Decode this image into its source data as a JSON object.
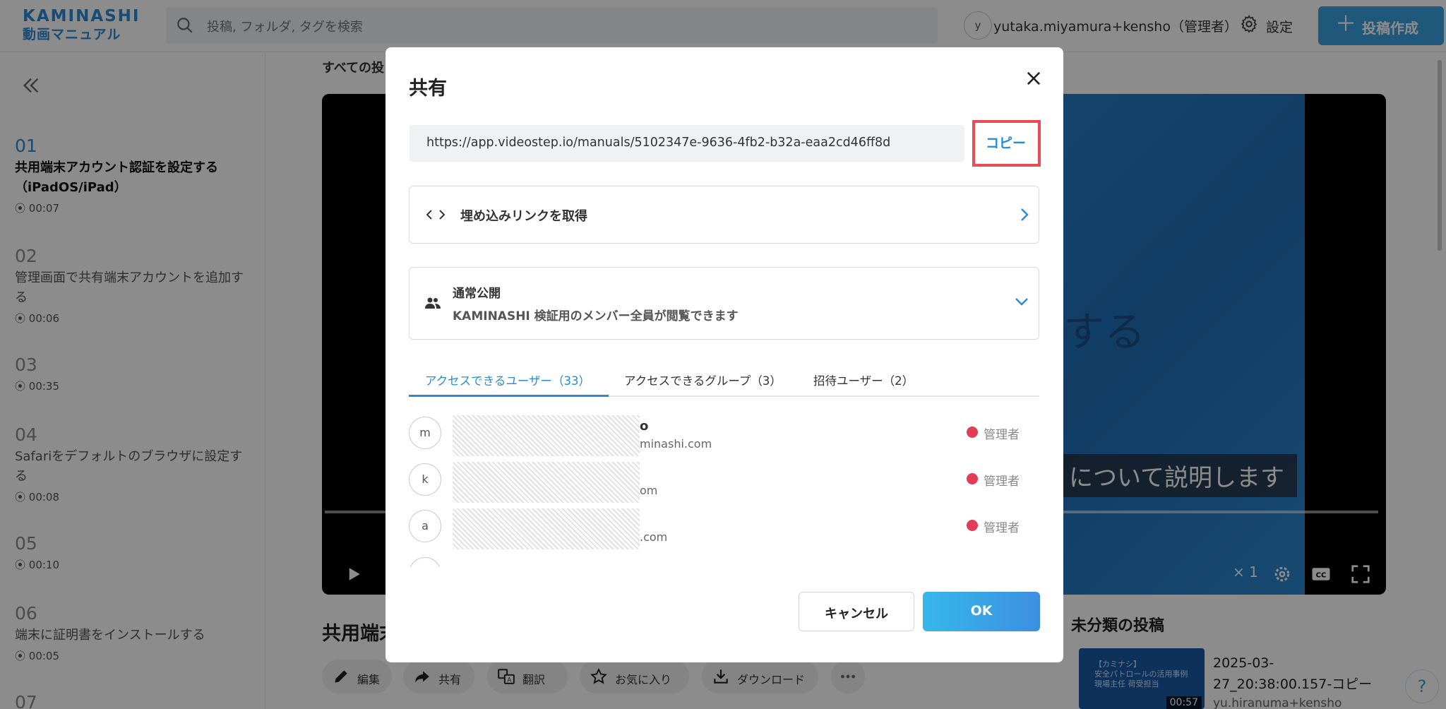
{
  "app": {
    "logo_line1": "KAMINASHI",
    "logo_line2": "動画マニュアル"
  },
  "header": {
    "search_placeholder": "投稿, フォルダ, タグを検索",
    "user_initial": "y",
    "user_name": "yutaka.miyamura+kensho（管理者）",
    "settings_label": "設定",
    "create_label": "投稿作成"
  },
  "sidebar": {
    "steps": [
      {
        "num": "01",
        "title": "共用端末アカウント認証を設定する（iPadOS/iPad）",
        "duration": "00:07"
      },
      {
        "num": "02",
        "title": "管理画面で共有端末アカウントを追加する",
        "duration": "00:06"
      },
      {
        "num": "03",
        "title": "",
        "duration": "00:35"
      },
      {
        "num": "04",
        "title": "Safariをデフォルトのブラウザに設定する",
        "duration": "00:08"
      },
      {
        "num": "05",
        "title": "",
        "duration": "00:10"
      },
      {
        "num": "06",
        "title": "端末に証明書をインストールする",
        "duration": "00:05"
      },
      {
        "num": "07",
        "title": "",
        "duration": ""
      }
    ]
  },
  "main": {
    "all_posts": "すべての投",
    "video_text": "する",
    "caption": "について説明します",
    "playback_rate": "× 1",
    "title": "共用端末",
    "actions": [
      "編集",
      "共有",
      "翻訳",
      "お気に入り",
      "ダウンロード"
    ],
    "right_title": "未分類の投稿",
    "right_item_name": "2025-03-27_20:38:00.157-コピー",
    "right_item_user": "yu.hiranuma+kensho",
    "right_item_duration": "00:57",
    "right_item_thumb_text": "【カミナシ】\n安全パトロールの活用事例\n現場主任 荷受担当"
  },
  "modal": {
    "title": "共有",
    "url": "https://app.videostep.io/manuals/5102347e-9636-4fb2-b32a-eaa2cd46ff8d",
    "copy_label": "コピー",
    "embed_label": "埋め込みリンクを取得",
    "visibility_title": "通常公開",
    "visibility_desc": "KAMINASHI 検証用のメンバー全員が閲覧できます",
    "tabs": [
      "アクセスできるユーザー（33）",
      "アクセスできるグループ（3）",
      "招待ユーザー（2）"
    ],
    "users": [
      {
        "initial": "m",
        "name_tail": "o",
        "email_tail": "minashi.com",
        "role": "管理者"
      },
      {
        "initial": "k",
        "name_tail": "",
        "email_tail": "om",
        "role": "管理者"
      },
      {
        "initial": "a",
        "name_tail": "",
        "email_tail": ".com",
        "role": "管理者"
      }
    ],
    "cancel_label": "キャンセル",
    "ok_label": "OK"
  },
  "help_label": "?",
  "colors": {
    "accent": "#2a8ad8",
    "highlight": "#e94c56",
    "admin_dot": "#e23c57"
  }
}
